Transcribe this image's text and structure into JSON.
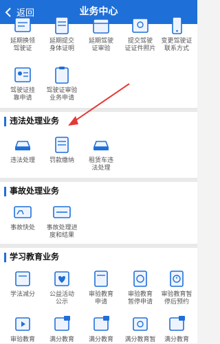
{
  "navbar": {
    "back_label": "返回",
    "title": "业务中心"
  },
  "top_rows": {
    "row1": [
      "延期换领\n驾驶证",
      "延期提交\n身体证明",
      "延期驾驶\n证审验",
      "提交驾驶\n证证件照片",
      "变更驾驶证\n联系方式"
    ],
    "row2": [
      "驾驶证挂\n靠申请",
      "驾驶证审验\n业务申请"
    ]
  },
  "sections": {
    "violation": {
      "title": "违法处理业务",
      "items": [
        "违法处理",
        "罚款缴纳",
        "租赁车违\n法处理"
      ]
    },
    "accident": {
      "title": "事故处理业务",
      "items": [
        "事故快处",
        "事故处理进\n度和结果"
      ]
    },
    "education": {
      "title": "学习教育业务",
      "row1": [
        "学法减分",
        "公益活动\n公示",
        "审验教育\n申请",
        "审验教育\n暂停申请",
        "审验教育暂\n停后预约"
      ],
      "row2": [
        "审验教育",
        "满分教育",
        "满分教育",
        "满分教育暂",
        "满分教育"
      ]
    }
  },
  "colors": {
    "nav": "#1f6fd8",
    "accent": "#e53935"
  }
}
